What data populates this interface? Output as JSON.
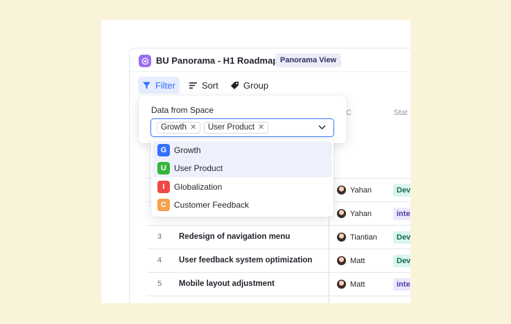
{
  "app": {
    "title": "BU Panorama - H1 Roadmap",
    "view_badge": "Panorama View",
    "accent": "#3370ff"
  },
  "toolbar": {
    "filter_label": "Filter",
    "sort_label": "Sort",
    "group_label": "Group"
  },
  "table": {
    "columns": [
      "C",
      "Stat"
    ],
    "rows": [
      {
        "num": "",
        "name": "",
        "owner": "Yahan",
        "status": "Dev",
        "status_kind": "dev"
      },
      {
        "num": "",
        "name": "",
        "owner": "Yahan",
        "status": "inte",
        "status_kind": "int"
      },
      {
        "num": "3",
        "name": "Redesign of navigation menu",
        "owner": "Tiantian",
        "status": "Dev",
        "status_kind": "dev"
      },
      {
        "num": "4",
        "name": "User feedback system optimization",
        "owner": "Matt",
        "status": "Dev",
        "status_kind": "dev"
      },
      {
        "num": "5",
        "name": "Mobile layout adjustment",
        "owner": "Matt",
        "status": "inte",
        "status_kind": "int"
      }
    ]
  },
  "filter_popover": {
    "label": "Data from Space",
    "selected": [
      "Growth",
      "User Product"
    ],
    "remove_glyph": "✕",
    "options": [
      {
        "letter": "G",
        "label": "Growth",
        "color": "#3370ff",
        "selected": true
      },
      {
        "letter": "U",
        "label": "User Product",
        "color": "#34b53a",
        "selected": true
      },
      {
        "letter": "I",
        "label": "Globalization",
        "color": "#f04848",
        "selected": false
      },
      {
        "letter": "C",
        "label": "Customer Feedback",
        "color": "#f5a04a",
        "selected": false
      }
    ]
  }
}
